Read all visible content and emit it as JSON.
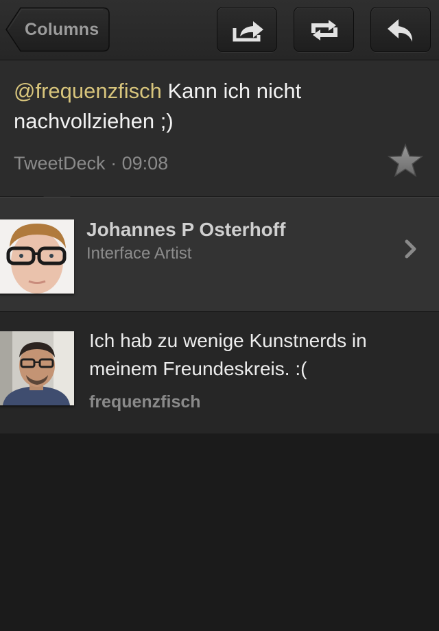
{
  "toolbar": {
    "back_label": "Columns",
    "buttons": [
      {
        "name": "share",
        "icon": "share-icon"
      },
      {
        "name": "retweet",
        "icon": "retweet-icon"
      },
      {
        "name": "reply",
        "icon": "reply-icon"
      }
    ]
  },
  "tweet": {
    "mention": "@frequenzfisch",
    "text": " Kann ich nicht nachvollziehen ;)",
    "client": "TweetDeck",
    "separator": " · ",
    "time": "09:08",
    "favorite_icon": "star-icon"
  },
  "author": {
    "name": "Johannes P Osterhoff",
    "bio": "Interface Artist",
    "chevron_icon": "chevron-right-icon"
  },
  "in_reply_to": {
    "text": "Ich hab zu wenige Kunstnerds in meinem Freundeskreis. :(",
    "username": "frequenzfisch"
  },
  "colors": {
    "background": "#1b1b1b",
    "mention": "#d8c57c",
    "text": "#f2f2f2",
    "meta": "#8a8a8a"
  }
}
